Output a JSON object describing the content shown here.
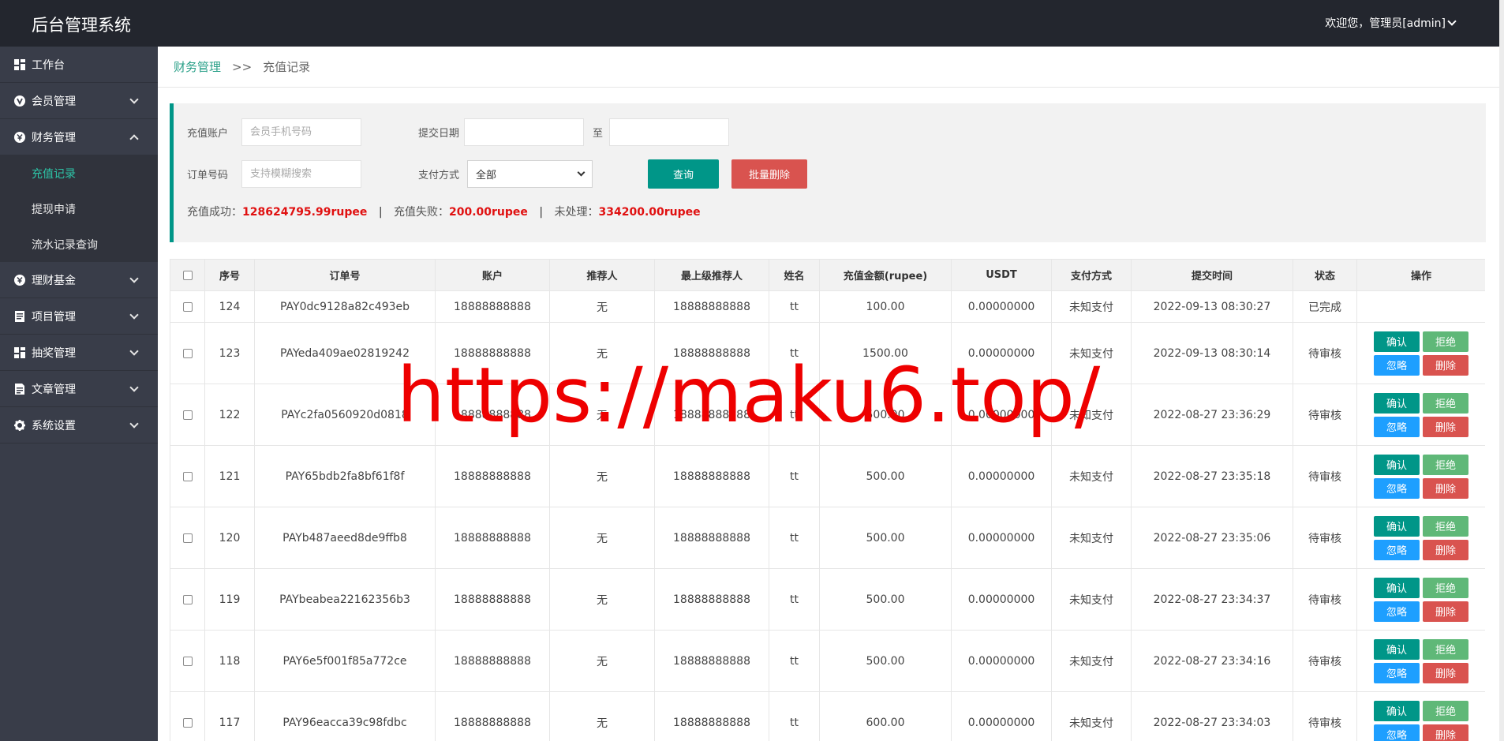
{
  "header": {
    "title": "后台管理系统",
    "user": "欢迎您，管理员[admin]"
  },
  "sidebar": {
    "items": [
      {
        "label": "工作台",
        "icon": "dashboard-icon",
        "expandable": false
      },
      {
        "label": "会员管理",
        "icon": "member-icon",
        "expandable": true
      },
      {
        "label": "财务管理",
        "icon": "finance-icon",
        "expandable": true,
        "expanded": true,
        "children": [
          {
            "label": "充值记录",
            "active": true
          },
          {
            "label": "提现申请"
          },
          {
            "label": "流水记录查询"
          }
        ]
      },
      {
        "label": "理财基金",
        "icon": "fund-icon",
        "expandable": true
      },
      {
        "label": "项目管理",
        "icon": "project-icon",
        "expandable": true
      },
      {
        "label": "抽奖管理",
        "icon": "lottery-icon",
        "expandable": true
      },
      {
        "label": "文章管理",
        "icon": "article-icon",
        "expandable": true
      },
      {
        "label": "系统设置",
        "icon": "settings-icon",
        "expandable": true
      }
    ]
  },
  "breadcrumb": {
    "parent": "财务管理",
    "separator": ">>",
    "current": "充值记录"
  },
  "filter": {
    "account_label": "充值账户",
    "account_placeholder": "会员手机号码",
    "date_label": "提交日期",
    "date_to": "至",
    "order_label": "订单号码",
    "order_placeholder": "支持模糊搜索",
    "pay_label": "支付方式",
    "pay_value": "全部",
    "query_btn": "查询",
    "batch_delete_btn": "批量删除"
  },
  "stats": {
    "success_label": "充值成功：",
    "success_value": "128624795.99rupee",
    "fail_label": "充值失败：",
    "fail_value": "200.00rupee",
    "pending_label": "未处理：",
    "pending_value": "334200.00rupee",
    "sep": "|"
  },
  "table": {
    "columns": [
      "序号",
      "订单号",
      "账户",
      "推荐人",
      "最上级推荐人",
      "姓名",
      "充值金额(rupee)",
      "USDT",
      "支付方式",
      "提交时间",
      "状态",
      "操作"
    ],
    "actions": {
      "confirm": "确认",
      "reject": "拒绝",
      "ignore": "忽略",
      "delete": "删除"
    },
    "rows": [
      {
        "id": "124",
        "order": "PAY0dc9128a82c493eb",
        "account": "18888888888",
        "referrer": "无",
        "top_referrer": "18888888888",
        "name": "tt",
        "amount": "100.00",
        "usdt": "0.00000000",
        "pay": "未知支付",
        "time": "2022-09-13 08:30:27",
        "status": "已完成",
        "pending": false
      },
      {
        "id": "123",
        "order": "PAYeda409ae02819242",
        "account": "18888888888",
        "referrer": "无",
        "top_referrer": "18888888888",
        "name": "tt",
        "amount": "1500.00",
        "usdt": "0.00000000",
        "pay": "未知支付",
        "time": "2022-09-13 08:30:14",
        "status": "待审核",
        "pending": true
      },
      {
        "id": "122",
        "order": "PAYc2fa0560920d0818",
        "account": "18888888888",
        "referrer": "无",
        "top_referrer": "18888888888",
        "name": "tt",
        "amount": "500.00",
        "usdt": "0.00000000",
        "pay": "未知支付",
        "time": "2022-08-27 23:36:29",
        "status": "待审核",
        "pending": true
      },
      {
        "id": "121",
        "order": "PAY65bdb2fa8bf61f8f",
        "account": "18888888888",
        "referrer": "无",
        "top_referrer": "18888888888",
        "name": "tt",
        "amount": "500.00",
        "usdt": "0.00000000",
        "pay": "未知支付",
        "time": "2022-08-27 23:35:18",
        "status": "待审核",
        "pending": true
      },
      {
        "id": "120",
        "order": "PAYb487aeed8de9ffb8",
        "account": "18888888888",
        "referrer": "无",
        "top_referrer": "18888888888",
        "name": "tt",
        "amount": "500.00",
        "usdt": "0.00000000",
        "pay": "未知支付",
        "time": "2022-08-27 23:35:06",
        "status": "待审核",
        "pending": true
      },
      {
        "id": "119",
        "order": "PAYbeabea22162356b3",
        "account": "18888888888",
        "referrer": "无",
        "top_referrer": "18888888888",
        "name": "tt",
        "amount": "500.00",
        "usdt": "0.00000000",
        "pay": "未知支付",
        "time": "2022-08-27 23:34:37",
        "status": "待审核",
        "pending": true
      },
      {
        "id": "118",
        "order": "PAY6e5f001f85a772ce",
        "account": "18888888888",
        "referrer": "无",
        "top_referrer": "18888888888",
        "name": "tt",
        "amount": "500.00",
        "usdt": "0.00000000",
        "pay": "未知支付",
        "time": "2022-08-27 23:34:16",
        "status": "待审核",
        "pending": true
      },
      {
        "id": "117",
        "order": "PAY96eacca39c98fdbc",
        "account": "18888888888",
        "referrer": "无",
        "top_referrer": "18888888888",
        "name": "tt",
        "amount": "600.00",
        "usdt": "0.00000000",
        "pay": "未知支付",
        "time": "2022-08-27 23:34:03",
        "status": "待审核",
        "pending": true
      }
    ]
  },
  "watermark": "https://maku6.top/",
  "colors": {
    "accent": "#009688",
    "danger": "#d9534f",
    "info": "#1e9fff",
    "success": "#5fb878",
    "highlight": "#e01010"
  }
}
